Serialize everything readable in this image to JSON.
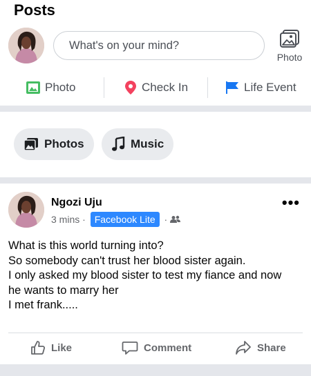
{
  "section_title": "Posts",
  "composer": {
    "placeholder": "What's on your mind?",
    "photo_label": "Photo"
  },
  "quick_actions": [
    {
      "label": "Photo",
      "icon": "photo-icon",
      "color": "#45bd62"
    },
    {
      "label": "Check In",
      "icon": "location-pin-icon",
      "color": "#f3425f"
    },
    {
      "label": "Life Event",
      "icon": "flag-icon",
      "color": "#1877f2"
    }
  ],
  "filters": [
    {
      "label": "Photos",
      "icon": "photos-icon"
    },
    {
      "label": "Music",
      "icon": "music-note-icon"
    }
  ],
  "post": {
    "author": "Ngozi Uju",
    "time": "3 mins",
    "source": "Facebook Lite",
    "audience_icon": "friends-icon",
    "body_lines": [
      "What is this world turning into?",
      "So somebody can't trust her blood sister again.",
      "I only asked my blood sister to test my fiance and now",
      "he wants to marry her",
      "I met frank....."
    ],
    "actions": [
      {
        "label": "Like",
        "icon": "thumbs-up-icon"
      },
      {
        "label": "Comment",
        "icon": "comment-icon"
      },
      {
        "label": "Share",
        "icon": "share-arrow-icon"
      }
    ]
  },
  "colors": {
    "badge": "#2d88ff",
    "divider": "#e4e6eb",
    "pill_bg": "#e9ebee",
    "muted_text": "#65676b"
  }
}
